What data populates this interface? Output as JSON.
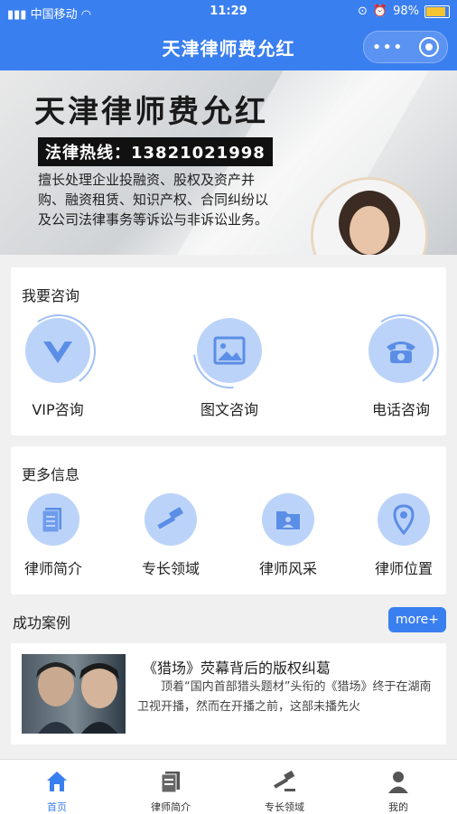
{
  "status_bar": {
    "carrier": "中国移动",
    "time": "11:29",
    "battery": "98%"
  },
  "nav": {
    "title": "天津律师费允红"
  },
  "banner": {
    "heading": "天津律师费允红",
    "hotline": "法律热线：13821021998",
    "description": "擅长处理企业投融资、股权及资产并购、融资租赁、知识产权、合同纠纷以及公司法律事务等诉讼与非诉讼业务。"
  },
  "consult": {
    "title": "我要咨询",
    "items": [
      {
        "label": "VIP咨询",
        "icon": "vip-icon"
      },
      {
        "label": "图文咨询",
        "icon": "image-icon"
      },
      {
        "label": "电话咨询",
        "icon": "phone-icon"
      }
    ]
  },
  "more_info": {
    "title": "更多信息",
    "items": [
      {
        "label": "律师简介",
        "icon": "document-icon"
      },
      {
        "label": "专长领域",
        "icon": "gavel-icon"
      },
      {
        "label": "律师风采",
        "icon": "folder-person-icon"
      },
      {
        "label": "律师位置",
        "icon": "location-icon"
      }
    ]
  },
  "cases": {
    "title": "成功案例",
    "more_label": "more+",
    "items": [
      {
        "title": "《猎场》荧幕背后的版权纠葛",
        "excerpt": "顶着“国内首部猎头题材”头衔的《猎场》终于在湖南卫视开播，然而在开播之前，这部未播先火"
      }
    ]
  },
  "tabbar": {
    "items": [
      {
        "label": "首页",
        "icon": "home-icon",
        "active": true
      },
      {
        "label": "律师简介",
        "icon": "document-icon",
        "active": false
      },
      {
        "label": "专长领域",
        "icon": "gavel-icon",
        "active": false
      },
      {
        "label": "我的",
        "icon": "user-icon",
        "active": false
      }
    ]
  },
  "colors": {
    "primary": "#3a7ff0",
    "icon_bg": "#bcd3f9",
    "icon_fg": "#5b8ee6"
  }
}
